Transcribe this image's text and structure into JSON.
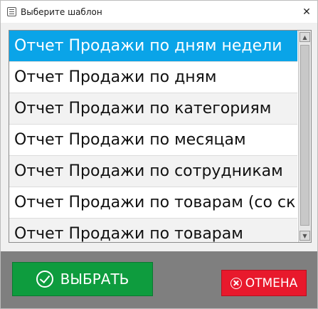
{
  "window": {
    "title": "Выберите шаблон",
    "close_glyph": "✕"
  },
  "templates": {
    "items": [
      "Отчет Продажи по дням недели",
      "Отчет Продажи по дням",
      "Отчет Продажи по категориям",
      "Отчет Продажи по месяцам",
      "Отчет Продажи по сотрудникам",
      "Отчет Продажи по товарам (со ск",
      "Отчет Продажи по товарам"
    ],
    "selected_index": 0
  },
  "scrollbar": {
    "up_glyph": "▲",
    "down_glyph": "▼"
  },
  "buttons": {
    "select_label": "ВЫБРАТЬ",
    "cancel_label": "ОТМЕНА"
  },
  "colors": {
    "selected_bg": "#0aa4e8",
    "select_button": "#0e9c3e",
    "cancel_button": "#e8192c",
    "bottom_panel": "#7f7f7f"
  }
}
